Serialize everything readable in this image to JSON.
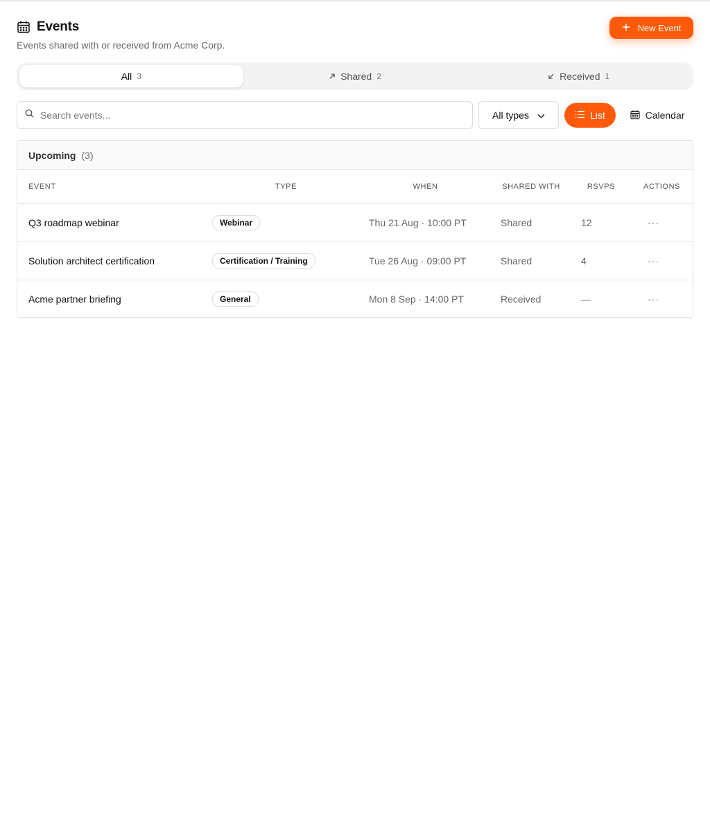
{
  "header": {
    "title": "Events",
    "subtitle": "Events shared with or received from Acme Corp.",
    "new_event_label": "New Event"
  },
  "tabs": [
    {
      "label": "All",
      "count": "3",
      "icon": "",
      "active": true
    },
    {
      "label": "Shared",
      "count": "2",
      "icon": "arrow-up-right-icon",
      "active": false
    },
    {
      "label": "Received",
      "count": "1",
      "icon": "arrow-down-left-icon",
      "active": false
    }
  ],
  "toolbar": {
    "search_placeholder": "Search events...",
    "type_filter": "All types",
    "list_label": "List",
    "calendar_label": "Calendar"
  },
  "section": {
    "label": "Upcoming",
    "count": "(3)"
  },
  "table": {
    "columns": [
      "EVENT",
      "TYPE",
      "WHEN",
      "SHARED WITH",
      "RSVPS",
      "ACTIONS"
    ],
    "rows": [
      {
        "event": "Q3 roadmap webinar",
        "type": "Webinar",
        "when": "Thu 21 Aug · 10:00 PT",
        "shared": "Shared",
        "rsvps": "12",
        "actions": "···"
      },
      {
        "event": "Solution architect certification",
        "type": "Certification / Training",
        "when": "Tue 26 Aug · 09:00 PT",
        "shared": "Shared",
        "rsvps": "4",
        "actions": "···"
      },
      {
        "event": "Acme partner briefing",
        "type": "General",
        "when": "Mon 8 Sep · 14:00 PT",
        "shared": "Received",
        "rsvps": "—",
        "actions": "···"
      }
    ]
  },
  "colors": {
    "accent": "#ff5a0a",
    "muted_text": "#6b6b6b",
    "border": "#e3e3e3"
  }
}
